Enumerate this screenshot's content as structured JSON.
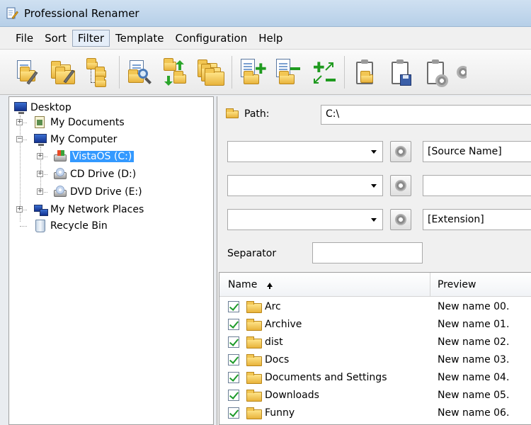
{
  "window": {
    "title": "Professional Renamer"
  },
  "menu": [
    "File",
    "Sort",
    "Filter",
    "Template",
    "Configuration",
    "Help"
  ],
  "menu_active": "Filter",
  "tree": {
    "desktop": "Desktop",
    "my_documents": "My Documents",
    "my_computer": "My Computer",
    "drive_c": "VistaOS (C:)",
    "drive_d": "CD Drive (D:)",
    "drive_e": "DVD Drive (E:)",
    "network": "My Network Places",
    "recycle": "Recycle Bin"
  },
  "path": {
    "label": "Path:",
    "value": "C:\\"
  },
  "rules": [
    {
      "combo": "",
      "field": "[Source Name]"
    },
    {
      "combo": "",
      "field": ""
    },
    {
      "combo": "",
      "field": "[Extension]"
    }
  ],
  "separator": {
    "label": "Separator",
    "value": ""
  },
  "list": {
    "columns": {
      "name": "Name",
      "preview": "Preview"
    },
    "rows": [
      {
        "name": "Arc",
        "preview": "New name 00."
      },
      {
        "name": "Archive",
        "preview": "New name 01."
      },
      {
        "name": "dist",
        "preview": "New name 02."
      },
      {
        "name": "Docs",
        "preview": "New name 03."
      },
      {
        "name": "Documents and Settings",
        "preview": "New name 04."
      },
      {
        "name": "Downloads",
        "preview": "New name 05."
      },
      {
        "name": "Funny",
        "preview": "New name 06."
      }
    ]
  },
  "icons": {
    "app": "renamer-app-icon",
    "toolbar": [
      "rename-files-icon",
      "rename-folders-icon",
      "tree-structure-icon",
      "preview-search-icon",
      "swap-folders-icon",
      "multiple-folders-icon",
      "add-file-icon",
      "remove-file-icon",
      "add-rule-icon",
      "clipboard-folder-icon",
      "clipboard-save-icon",
      "clipboard-settings-icon"
    ]
  }
}
